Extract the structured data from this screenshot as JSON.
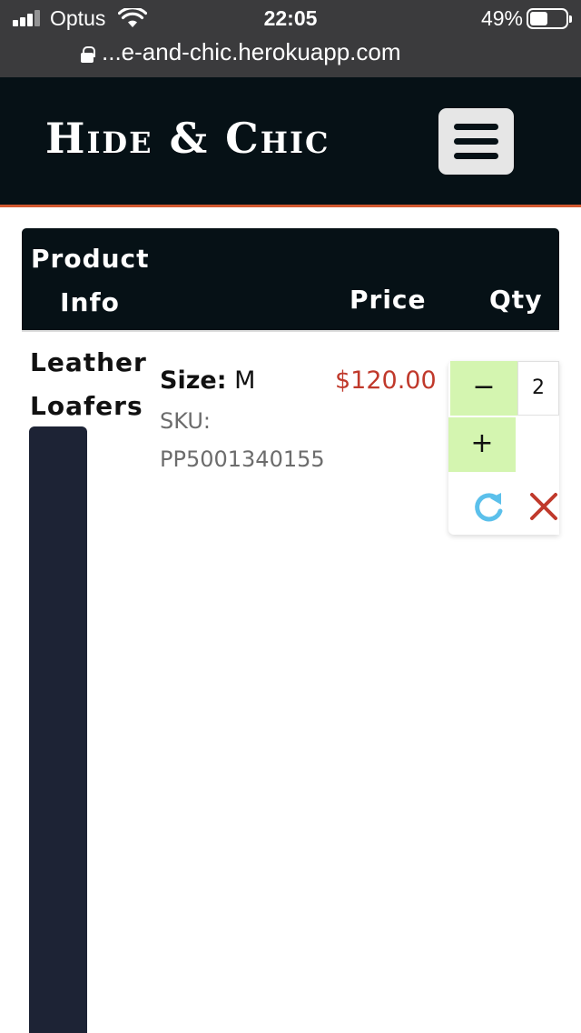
{
  "status_bar": {
    "carrier": "Optus",
    "time": "22:05",
    "battery_percent": "49%",
    "battery_level": 0.49,
    "icons": [
      "signal-icon",
      "wifi-icon",
      "battery-icon"
    ]
  },
  "browser": {
    "url": "...e-and-chic.herokuapp.com",
    "icons": [
      "lock-icon"
    ]
  },
  "header": {
    "brand": "Hide & Chic",
    "menu_icon": "hamburger-icon",
    "colors": {
      "background": "#061116",
      "accent_border": "#d2582f",
      "menu_button": "#e6e6e6"
    }
  },
  "cart": {
    "columns": {
      "product_info_line1": "Product",
      "product_info_line2": "Info",
      "price": "Price",
      "qty": "Qty"
    },
    "items": [
      {
        "name_line1": "Leather",
        "name_line2": "Loafers",
        "size_label": "Size:",
        "size_value": "M",
        "sku_label": "SKU:",
        "sku_value": "PP5001340155",
        "price": "$120.00",
        "quantity": "2",
        "decrement_label": "−",
        "increment_label": "+",
        "icons": [
          "refresh-icon",
          "remove-icon"
        ]
      }
    ],
    "colors": {
      "price": "#c0392b",
      "qty_button": "#d4f5b0",
      "refresh": "#5bc0eb",
      "remove": "#c0392b"
    }
  }
}
